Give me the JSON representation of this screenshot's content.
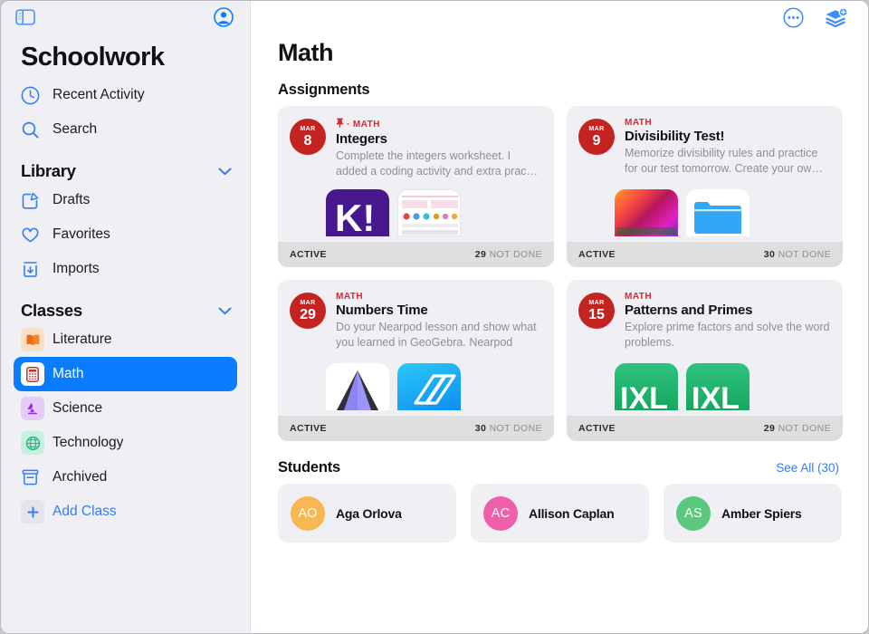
{
  "window": {
    "background": "#ffffff"
  },
  "sidebar": {
    "toggle_icon": "sidebar-toggle-icon",
    "account_icon": "account-circle-icon",
    "title": "Schoolwork",
    "top_items": [
      {
        "label": "Recent Activity",
        "icon": "clock-icon"
      },
      {
        "label": "Search",
        "icon": "search-icon"
      }
    ],
    "library": {
      "title": "Library",
      "chevron": "chevron-down-icon",
      "items": [
        {
          "label": "Drafts",
          "icon": "compose-icon"
        },
        {
          "label": "Favorites",
          "icon": "heart-icon"
        },
        {
          "label": "Imports",
          "icon": "import-download-icon"
        }
      ]
    },
    "classes": {
      "title": "Classes",
      "chevron": "chevron-down-icon",
      "items": [
        {
          "label": "Literature",
          "icon": "book-icon",
          "glyph": "📖",
          "bg": "#fadfc4",
          "selected": false
        },
        {
          "label": "Math",
          "icon": "calculator-icon",
          "glyph": "🧮",
          "bg": "#ffffff",
          "selected": true
        },
        {
          "label": "Science",
          "icon": "microscope-icon",
          "glyph": "🔬",
          "bg": "#e3cdf7",
          "selected": false
        },
        {
          "label": "Technology",
          "icon": "globe-icon",
          "glyph": "🌐",
          "bg": "#c9efdf",
          "selected": false
        },
        {
          "label": "Archived",
          "icon": "archive-box-icon",
          "glyph": "",
          "bg": "transparent",
          "selected": false
        }
      ],
      "add_class": {
        "label": "Add Class",
        "icon": "plus-icon"
      }
    }
  },
  "header": {
    "more_icon": "more-ellipsis-circle-icon",
    "new_assignment_icon": "stack-plus-icon"
  },
  "main": {
    "page_title": "Math",
    "assignments_heading": "Assignments",
    "assignments": [
      {
        "month": "MAR",
        "day": "8",
        "pinned": true,
        "pin_icon": "pin-icon",
        "subject": "MATH",
        "title": "Integers",
        "description": "Complete the integers worksheet. I added a coding activity and extra prac…",
        "status": "ACTIVE",
        "not_done_count": "29",
        "not_done_label": "NOT DONE",
        "thumbs": [
          "kahoot-app-icon",
          "worksheet-document-thumbnail"
        ]
      },
      {
        "month": "MAR",
        "day": "9",
        "pinned": false,
        "pin_icon": "",
        "subject": "MATH",
        "title": "Divisibility Test!",
        "description": "Memorize divisibility rules and practice for our test tomorrow. Create your ow…",
        "status": "ACTIVE",
        "not_done_count": "30",
        "not_done_label": "NOT DONE",
        "thumbs": [
          "gradient-app-icon",
          "files-folder-icon"
        ]
      },
      {
        "month": "MAR",
        "day": "29",
        "pinned": false,
        "pin_icon": "",
        "subject": "MATH",
        "title": "Numbers Time",
        "description": "Do your Nearpod lesson and show what you learned in GeoGebra. Nearpod",
        "status": "ACTIVE",
        "not_done_count": "30",
        "not_done_label": "NOT DONE",
        "thumbs": [
          "geogebra-app-icon",
          "nearpod-app-icon"
        ]
      },
      {
        "month": "MAR",
        "day": "15",
        "pinned": false,
        "pin_icon": "",
        "subject": "MATH",
        "title": "Patterns and Primes",
        "description": "Explore prime factors and solve the word problems.",
        "status": "ACTIVE",
        "not_done_count": "29",
        "not_done_label": "NOT DONE",
        "thumbs": [
          "ixl-app-icon",
          "ixl-app-icon"
        ]
      }
    ],
    "students_heading": "Students",
    "see_all": "See All (30)",
    "students": [
      {
        "initials": "AO",
        "name": "Aga Orlova",
        "color": "#f7b751"
      },
      {
        "initials": "AC",
        "name": "Allison Caplan",
        "color": "#f060a8"
      },
      {
        "initials": "AS",
        "name": "Amber Spiers",
        "color": "#5bc97d"
      }
    ]
  },
  "colors": {
    "accent": "#0a7cff",
    "link": "#2e7ef7",
    "subject_red": "#e0262c",
    "date_badge": "#c4241f",
    "sidebar_bg": "#f0f0f4",
    "card_bg": "#f0f0f4",
    "card_footer_bg": "#dededf"
  }
}
